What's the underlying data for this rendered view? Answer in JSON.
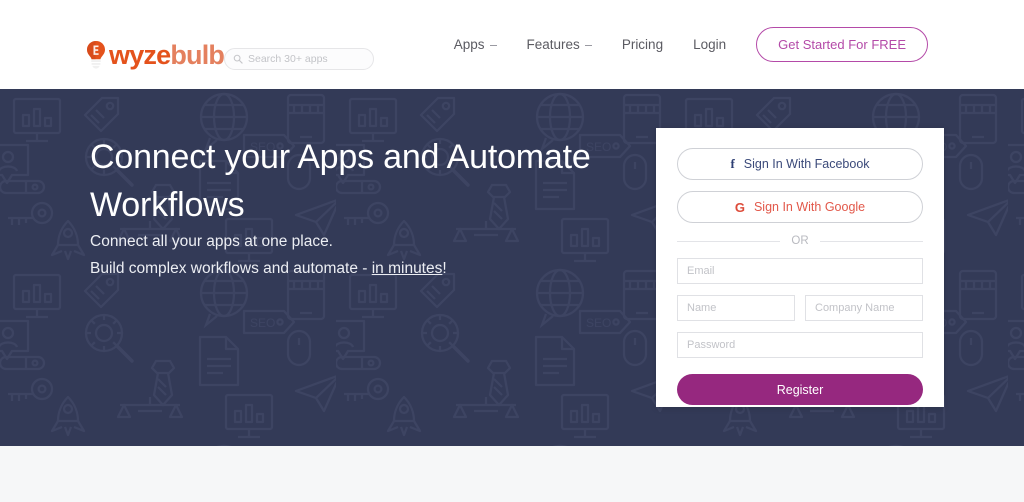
{
  "header": {
    "logo": {
      "icon": "lightbulb-icon",
      "text_part1": "wyze",
      "text_part2": "bulb",
      "color_part1": "#e4521c",
      "color_part2": "#e4805e"
    },
    "search": {
      "icon": "search-icon",
      "placeholder": "Search 30+ apps",
      "value": ""
    },
    "nav": [
      {
        "label": "Apps",
        "has_caret": true
      },
      {
        "label": "Features",
        "has_caret": true
      },
      {
        "label": "Pricing",
        "has_caret": false
      },
      {
        "label": "Login",
        "has_caret": false
      }
    ],
    "cta": {
      "label": "Get Started For FREE",
      "color": "#b44aa8"
    }
  },
  "hero": {
    "background_color": "#333a57",
    "title": "Connect your Apps and Automate Workflows",
    "subtitle_line1": "Connect all your apps at one place.",
    "subtitle_line2_prefix": "Build complex workflows and automate - ",
    "subtitle_line2_link": "in minutes",
    "subtitle_line2_suffix": "!"
  },
  "signup_card": {
    "facebook_button": {
      "glyph": "facebook-f-icon",
      "label": "Sign In With Facebook",
      "color": "#3b4a7a"
    },
    "google_button": {
      "glyph": "google-g-icon",
      "label": "Sign In With Google",
      "color": "#e2584a"
    },
    "divider_text": "OR",
    "fields": {
      "email_placeholder": "Email",
      "email_value": "",
      "name_placeholder": "Name",
      "name_value": "",
      "company_placeholder": "Company Name",
      "company_value": "",
      "password_placeholder": "Password",
      "password_value": ""
    },
    "submit": {
      "label": "Register",
      "color": "#96287f"
    }
  },
  "footer_strip": {
    "background_color": "#f6f7f8"
  }
}
